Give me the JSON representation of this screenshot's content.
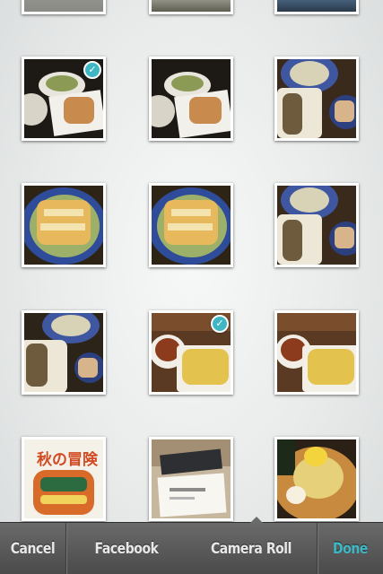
{
  "toolbar": {
    "cancel_label": "Cancel",
    "facebook_label": "Facebook",
    "camera_roll_label": "Camera Roll",
    "done_label": "Done"
  },
  "photos": [
    {
      "row": 0,
      "col": 0,
      "selected": false,
      "kind": "partial-top"
    },
    {
      "row": 0,
      "col": 1,
      "selected": false,
      "kind": "partial-top"
    },
    {
      "row": 0,
      "col": 2,
      "selected": false,
      "kind": "partial-top"
    },
    {
      "row": 1,
      "col": 0,
      "selected": true,
      "kind": "salad-karaage"
    },
    {
      "row": 1,
      "col": 1,
      "selected": false,
      "kind": "salad-karaage"
    },
    {
      "row": 1,
      "col": 2,
      "selected": false,
      "kind": "fish-salad"
    },
    {
      "row": 2,
      "col": 0,
      "selected": false,
      "kind": "chicken-plate"
    },
    {
      "row": 2,
      "col": 1,
      "selected": false,
      "kind": "chicken-plate"
    },
    {
      "row": 2,
      "col": 2,
      "selected": false,
      "kind": "fish-salad"
    },
    {
      "row": 3,
      "col": 0,
      "selected": false,
      "kind": "fish-salad"
    },
    {
      "row": 3,
      "col": 1,
      "selected": true,
      "kind": "curry-rice"
    },
    {
      "row": 3,
      "col": 2,
      "selected": false,
      "kind": "curry-rice"
    },
    {
      "row": 4,
      "col": 0,
      "selected": false,
      "kind": "book-cover"
    },
    {
      "row": 4,
      "col": 1,
      "selected": false,
      "kind": "box-card"
    },
    {
      "row": 4,
      "col": 2,
      "selected": false,
      "kind": "ramen"
    }
  ],
  "book_cover_title": "秋の冒険",
  "check_glyph": "✓",
  "colors": {
    "accent": "#3fb6c4",
    "toolbar_top": "#6a6a6a",
    "toolbar_bottom": "#4a4a4a",
    "toolbar_text": "#e8e8e8"
  }
}
